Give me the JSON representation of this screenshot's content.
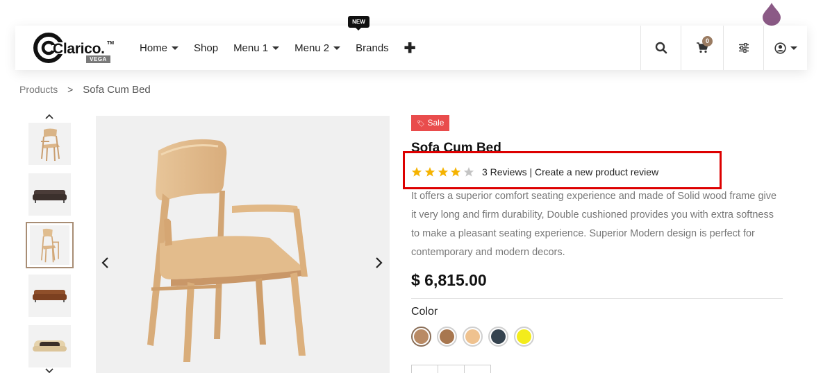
{
  "header": {
    "logo_text": "Clarico.",
    "logo_tm": "TM",
    "logo_badge": "VEGA",
    "nav": [
      {
        "label": "Home",
        "dropdown": true
      },
      {
        "label": "Shop",
        "dropdown": false
      },
      {
        "label": "Menu 1",
        "dropdown": true
      },
      {
        "label": "Menu 2",
        "dropdown": true
      },
      {
        "label": "Brands",
        "dropdown": false,
        "badge": "NEW"
      }
    ],
    "cart_count": "0",
    "icons": [
      "search-icon",
      "cart-icon",
      "sliders-icon",
      "user-circle-icon"
    ]
  },
  "breadcrumb": {
    "parent": "Products",
    "separator": ">",
    "current": "Sofa Cum Bed"
  },
  "product": {
    "sale_label": "Sale",
    "title": "Sofa Cum Bed",
    "rating": 4,
    "rating_max": 5,
    "reviews_text": "3 Reviews | Create a new product review",
    "description": "It offers a superior comfort seating experience and made of Solid wood frame give it very long and firm durability, Double cushioned provides you with extra softness to make a pleasant seating experience. Superior Modern design is perfect for contemporary and modern decors.",
    "price": "$ 6,815.00",
    "color_label": "Color",
    "colors": [
      "#b98a64",
      "#a8774f",
      "#efc28f",
      "#35434f",
      "#f3ec1c"
    ],
    "selected_color_index": 0
  },
  "gallery": {
    "thumbnails": [
      "wooden-chair",
      "dark-sofa",
      "wooden-chair",
      "brown-sofa",
      "beige-sofa"
    ],
    "active_index": 2
  },
  "colors": {
    "accent": "#9a7b61",
    "sale": "#e94c4c",
    "star_filled": "#f5b301",
    "star_empty": "#c4c4c4",
    "highlight": "#dd0000",
    "drop": "#8b5a86"
  }
}
